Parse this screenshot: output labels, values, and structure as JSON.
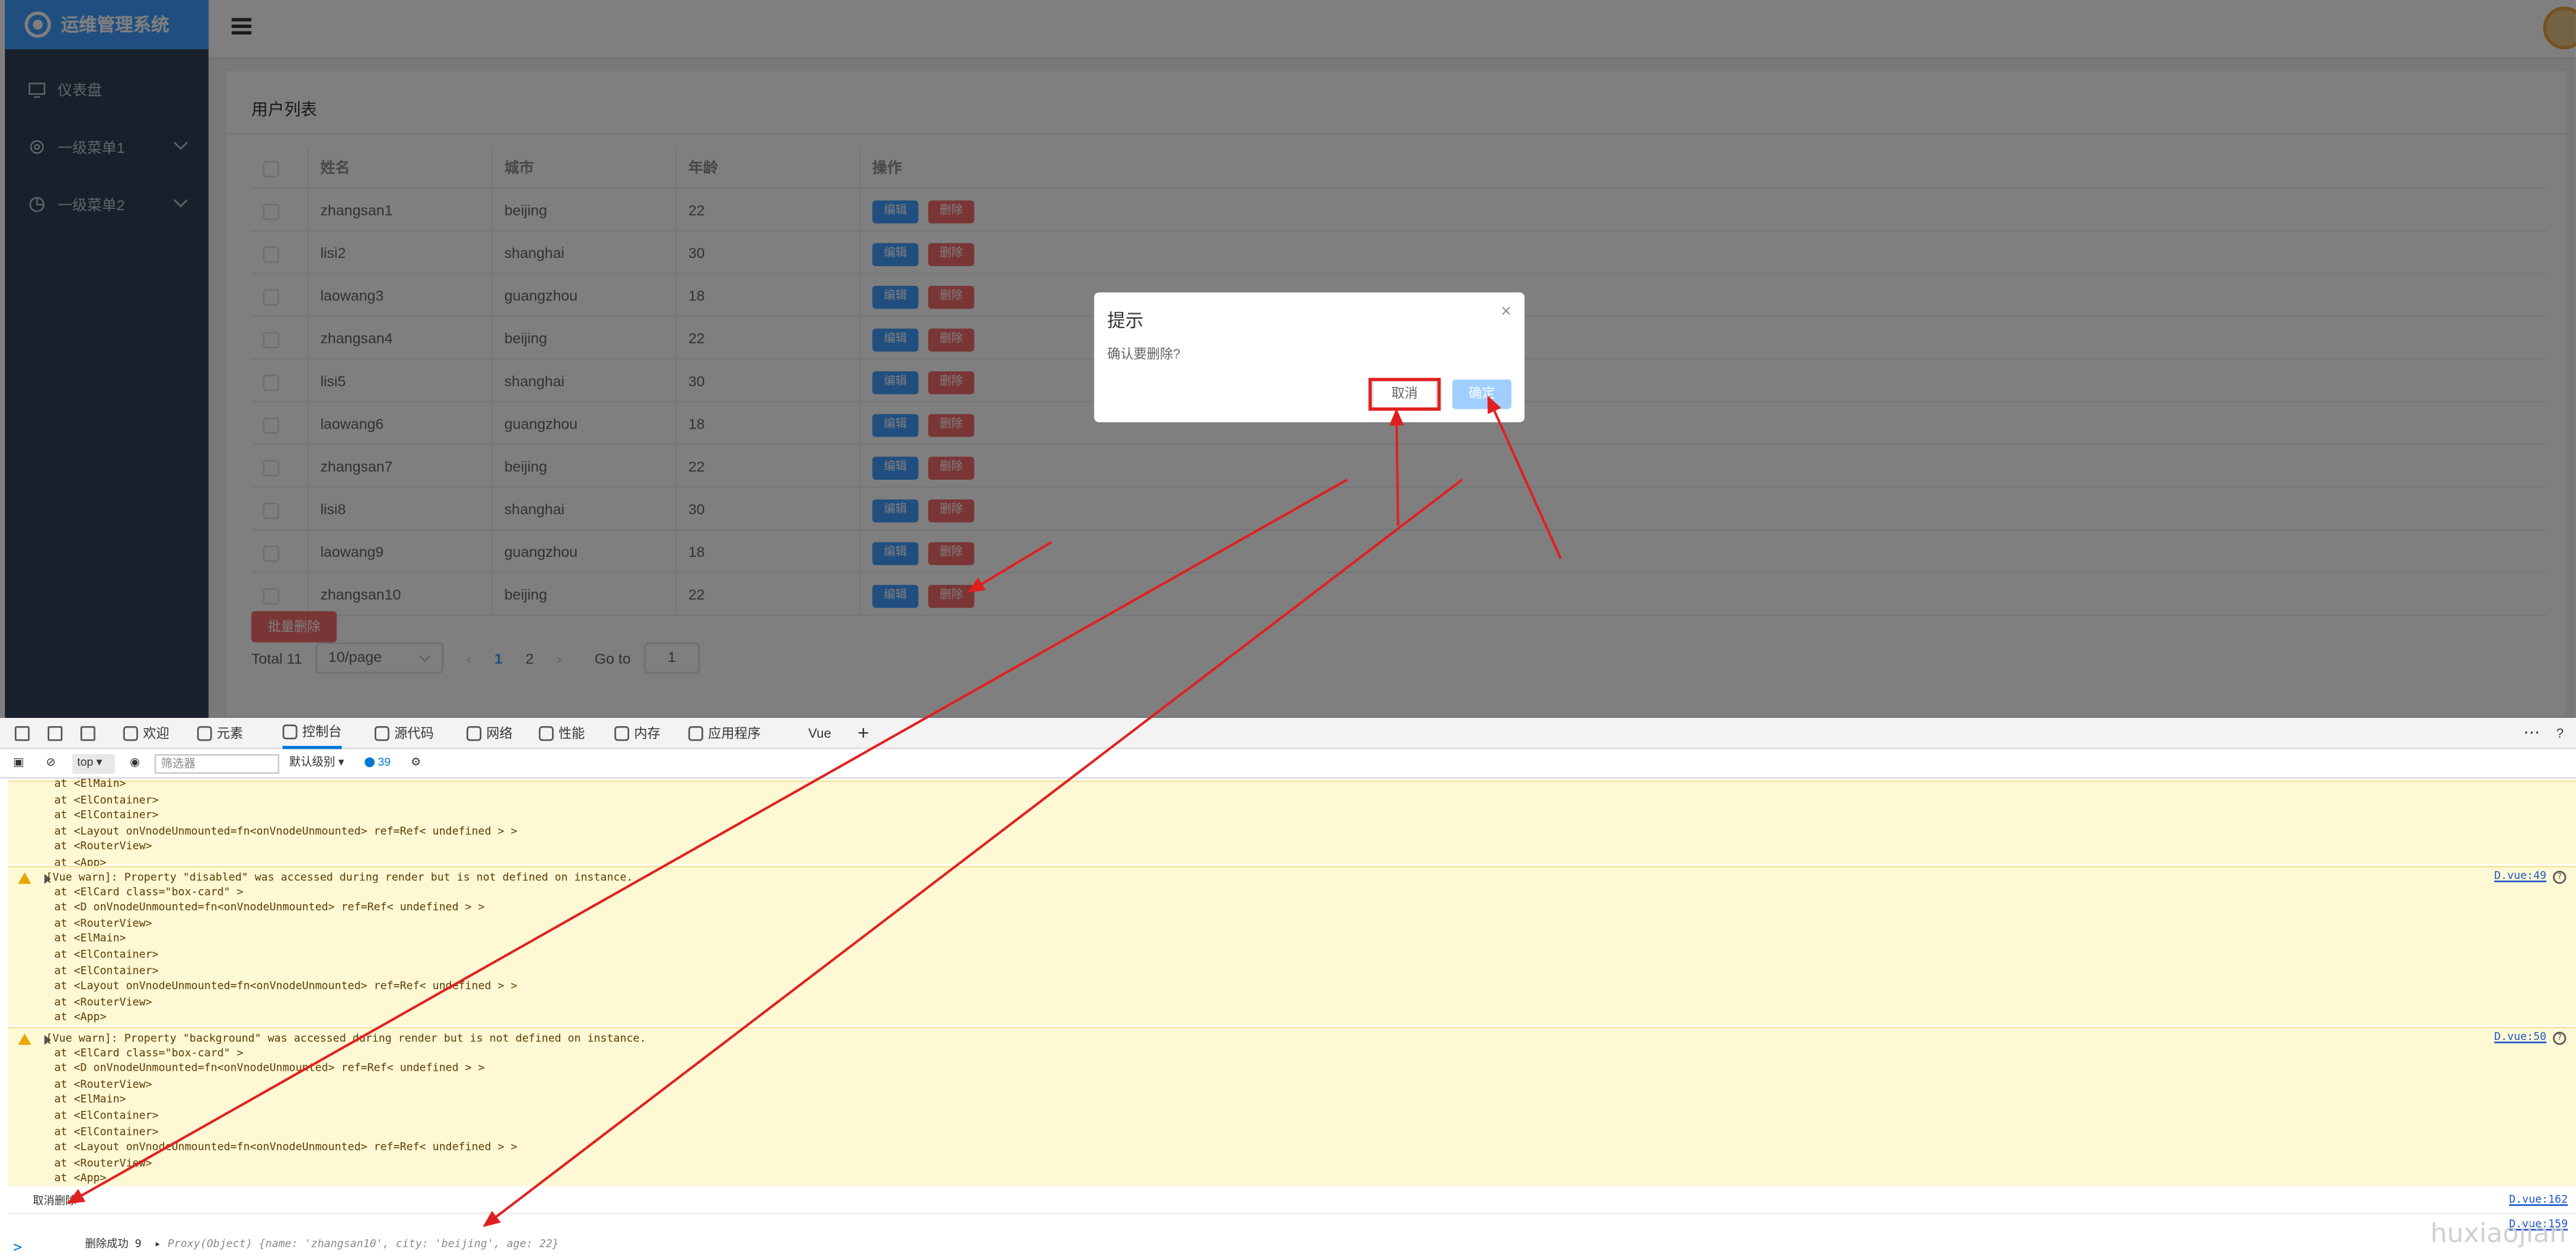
{
  "app": {
    "logo_text": "运维管理系统",
    "sidebar": {
      "items": [
        {
          "label": "仪表盘",
          "icon": "monitor-icon"
        },
        {
          "label": "一级菜单1",
          "icon": "gear-icon"
        },
        {
          "label": "一级菜单2",
          "icon": "pie-chart-icon"
        }
      ]
    },
    "card_title": "用户列表",
    "table": {
      "headers": [
        "姓名",
        "城市",
        "年龄",
        "操作"
      ],
      "rows": [
        {
          "name": "zhangsan1",
          "city": "beijing",
          "age": "22"
        },
        {
          "name": "lisi2",
          "city": "shanghai",
          "age": "30"
        },
        {
          "name": "laowang3",
          "city": "guangzhou",
          "age": "18"
        },
        {
          "name": "zhangsan4",
          "city": "beijing",
          "age": "22"
        },
        {
          "name": "lisi5",
          "city": "shanghai",
          "age": "30"
        },
        {
          "name": "laowang6",
          "city": "guangzhou",
          "age": "18"
        },
        {
          "name": "zhangsan7",
          "city": "beijing",
          "age": "22"
        },
        {
          "name": "lisi8",
          "city": "shanghai",
          "age": "30"
        },
        {
          "name": "laowang9",
          "city": "guangzhou",
          "age": "18"
        },
        {
          "name": "zhangsan10",
          "city": "beijing",
          "age": "22"
        }
      ],
      "edit_label": "编辑",
      "delete_label": "删除"
    },
    "batch_delete_label": "批量删除",
    "pager": {
      "total": "Total 11",
      "page_size": "10/page",
      "pages": [
        "1",
        "2"
      ],
      "current_page": "1",
      "goto_label": "Go to",
      "goto_value": "1"
    },
    "dialog": {
      "title": "提示",
      "message": "确认要删除?",
      "close": "×",
      "cancel_label": "取消",
      "ok_label": "确定"
    }
  },
  "devtools": {
    "tabs": [
      {
        "label": "欢迎",
        "icon": "home-icon"
      },
      {
        "label": "元素",
        "icon": "code-icon"
      },
      {
        "label": "控制台",
        "icon": "console-icon",
        "active": true
      },
      {
        "label": "源代码",
        "icon": "bug-icon"
      },
      {
        "label": "网络",
        "icon": "wifi-icon"
      },
      {
        "label": "性能",
        "icon": "gauge-icon"
      },
      {
        "label": "内存",
        "icon": "memory-icon"
      },
      {
        "label": "应用程序",
        "icon": "app-icon"
      },
      {
        "label": "Vue",
        "icon": ""
      }
    ],
    "add_tab": "+",
    "toolbar": {
      "context": "top",
      "filter_placeholder": "筛选器",
      "level": "默认级别",
      "issue_count": "39"
    },
    "console": {
      "block1": [
        "at <ElMain>",
        "at <ElContainer>",
        "at <ElContainer>",
        "at <Layout onVnodeUnmounted=fn<onVnodeUnmounted> ref=Ref< undefined > >",
        "at <RouterView>",
        "at <App>"
      ],
      "warn2": {
        "message": "[Vue warn]: Property \"disabled\" was accessed during render but is not defined on instance.",
        "source": "D.vue:49",
        "stack": [
          "at <ElCard class=\"box-card\" >",
          "at <D onVnodeUnmounted=fn<onVnodeUnmounted> ref=Ref< undefined > >",
          "at <RouterView>",
          "at <ElMain>",
          "at <ElContainer>",
          "at <ElContainer>",
          "at <Layout onVnodeUnmounted=fn<onVnodeUnmounted> ref=Ref< undefined > >",
          "at <RouterView>",
          "at <App>"
        ]
      },
      "warn3": {
        "message": "[Vue warn]: Property \"background\" was accessed during render but is not defined on instance.",
        "source": "D.vue:50",
        "stack": [
          "at <ElCard class=\"box-card\" >",
          "at <D onVnodeUnmounted=fn<onVnodeUnmounted> ref=Ref< undefined > >",
          "at <RouterView>",
          "at <ElMain>",
          "at <ElContainer>",
          "at <ElContainer>",
          "at <Layout onVnodeUnmounted=fn<onVnodeUnmounted> ref=Ref< undefined > >",
          "at <RouterView>",
          "at <App>"
        ]
      },
      "log_cancel": {
        "text": "取消删除",
        "source": "D.vue:162"
      },
      "log_success": {
        "prefix": "删除成功 9",
        "object": "Proxy(Object) {name: 'zhangsan10', city: 'beijing', age: 22}",
        "source": "D.vue:159"
      },
      "prompt": ">"
    },
    "watermark": "huxiaojian"
  },
  "colors": {
    "sidebar": "#304156",
    "logo_bar": "#409eff",
    "primary": "#409eff",
    "danger": "#f56c6c",
    "annotation": "#e02020",
    "warning_bg": "#fff8d5"
  }
}
